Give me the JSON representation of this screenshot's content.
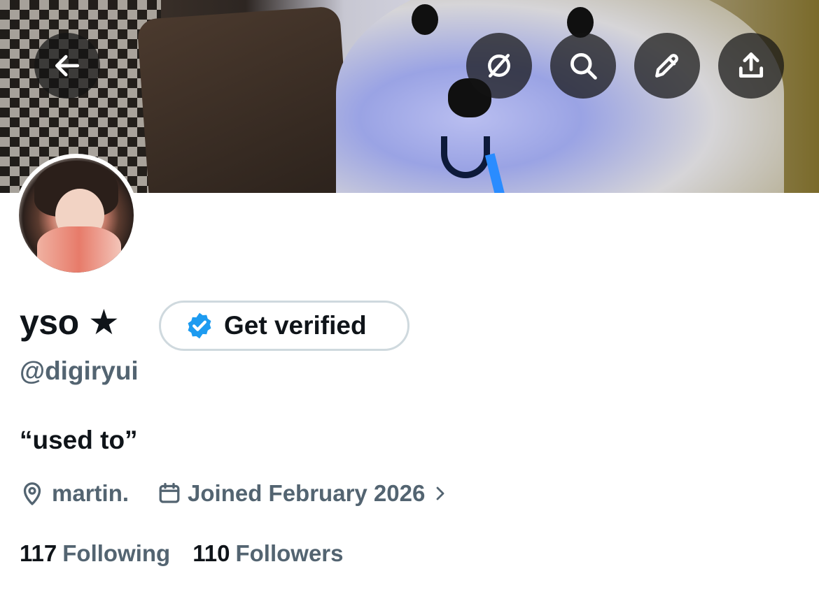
{
  "profile": {
    "display_name": "yso ★",
    "handle": "@digiryui",
    "bio": "“used to”",
    "location": "martin.",
    "joined": "Joined February 2026",
    "following_count": "117",
    "following_label": "Following",
    "followers_count": "110",
    "followers_label": "Followers"
  },
  "actions": {
    "get_verified_label": "Get verified"
  },
  "nav_icons": [
    "arrow-left-icon",
    "grok-icon",
    "search-icon",
    "pencil-icon",
    "share-icon"
  ],
  "colors": {
    "text_primary": "#0f1419",
    "text_secondary": "#536471",
    "verified_blue": "#1d9bf0",
    "button_border": "#cfd9de"
  }
}
